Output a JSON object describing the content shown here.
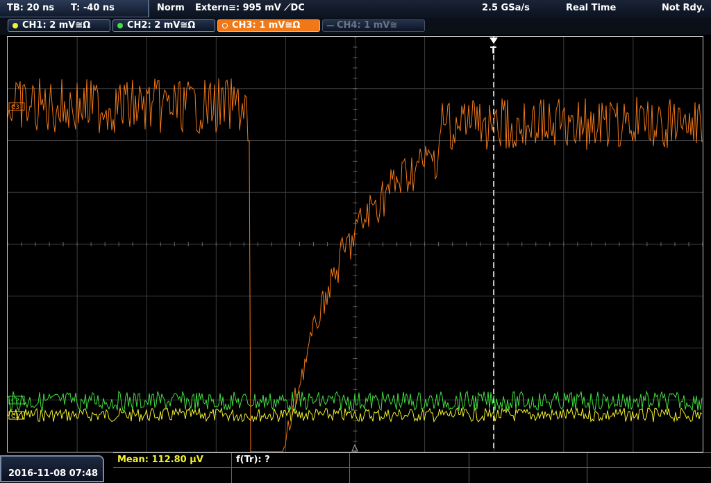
{
  "header": {
    "timebase": "TB: 20 ns",
    "trigger_offset": "T: -40 ns",
    "trigger_mode": "Norm",
    "trigger_source": "Extern≅: 995 mV ⟋DC",
    "sample_rate": "2.5 GSa/s",
    "acq_mode": "Real Time",
    "status": "Not Rdy."
  },
  "channels": [
    {
      "label": "CH1: 2 mV≅Ω",
      "color": "#f2f230",
      "state": "on"
    },
    {
      "label": "CH2: 2 mV≅Ω",
      "color": "#40e040",
      "state": "on"
    },
    {
      "label": "CH3: 1 mV≅Ω",
      "color": "#f07818",
      "state": "active"
    },
    {
      "label": "CH4: 1 mV≅",
      "color": "#5a6070",
      "state": "off"
    }
  ],
  "markers": {
    "ch3": "C3",
    "ch2": "C2",
    "ch1": "C1",
    "trigger": "T"
  },
  "footer": {
    "datetime": "2016-11-08 07:48",
    "mean_label": "Mean: 112.80 µV",
    "ftr_label": "f(Tr): ?"
  },
  "colors": {
    "ch1": "#f2f230",
    "ch2": "#40e040",
    "ch3": "#f07818",
    "grid": "#3c3c3c"
  }
}
